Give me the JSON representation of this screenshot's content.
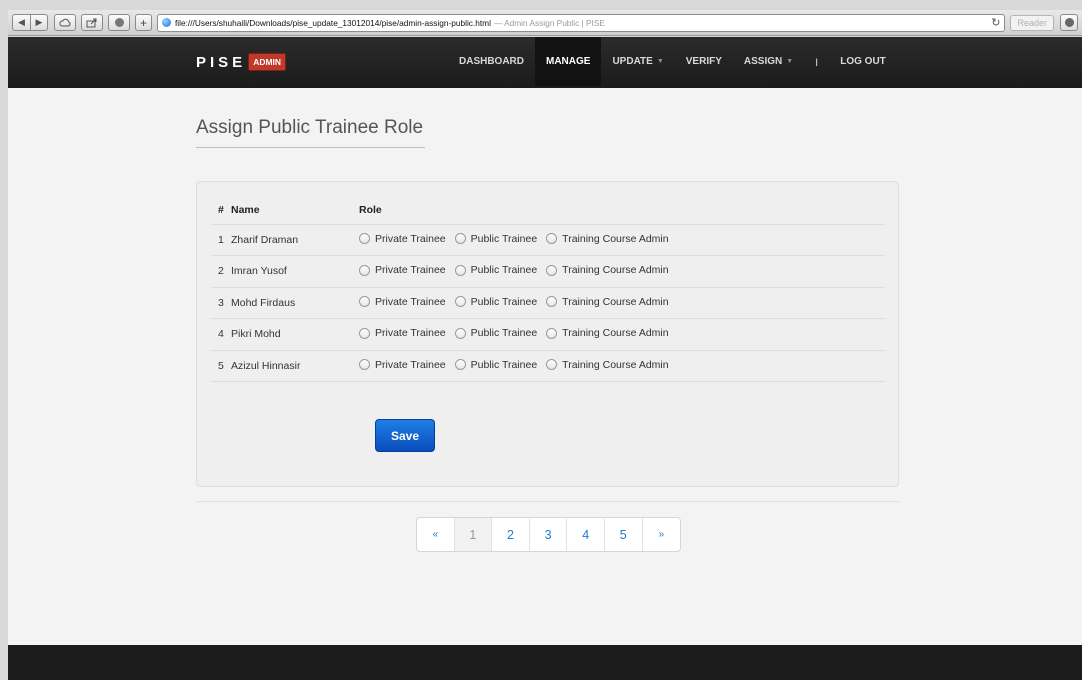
{
  "browser": {
    "url": "file:///Users/shuhaili/Downloads/pise_update_13012014/pise/admin-assign-public.html",
    "page_title": "— Admin Assign Public | PISE",
    "reader_label": "Reader"
  },
  "nav": {
    "brand": "PISE",
    "badge": "ADMIN",
    "items": [
      {
        "label": "DASHBOARD"
      },
      {
        "label": "MANAGE"
      },
      {
        "label": "UPDATE"
      },
      {
        "label": "VERIFY"
      },
      {
        "label": "ASSIGN"
      }
    ],
    "separator": "I",
    "logout": "LOG OUT"
  },
  "page": {
    "title": "Assign Public Trainee Role"
  },
  "table": {
    "headers": [
      "#",
      "Name",
      "Role"
    ],
    "role_options": [
      "Private Trainee",
      "Public Trainee",
      "Training Course Admin"
    ],
    "rows": [
      {
        "num": "1",
        "name": "Zharif Draman"
      },
      {
        "num": "2",
        "name": "Imran Yusof"
      },
      {
        "num": "3",
        "name": "Mohd Firdaus"
      },
      {
        "num": "4",
        "name": "Pikri Mohd"
      },
      {
        "num": "5",
        "name": "Azizul Hinnasir"
      }
    ]
  },
  "save_label": "Save",
  "pagination": {
    "prev": "«",
    "pages": [
      "1",
      "2",
      "3",
      "4",
      "5"
    ],
    "next": "»",
    "current": "1"
  },
  "colors": {
    "nav_bg": "#1b1b1b",
    "badge": "#c0392b",
    "primary": "#0a4dbd",
    "link": "#1f7bd0"
  }
}
